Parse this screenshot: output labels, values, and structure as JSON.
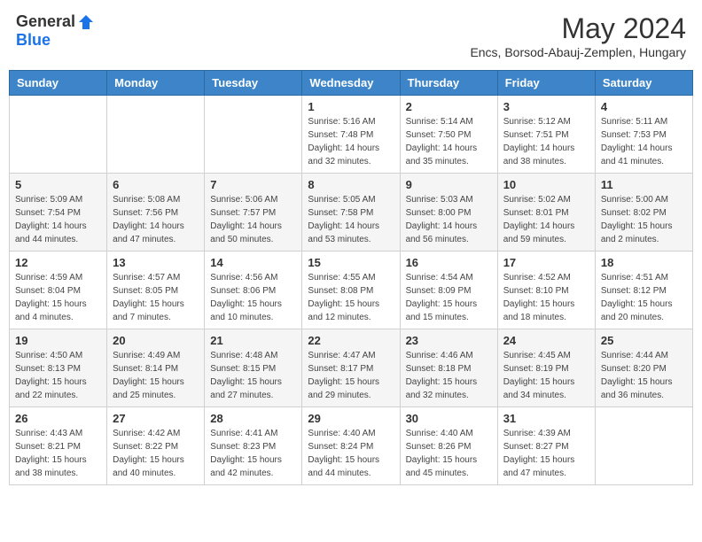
{
  "header": {
    "logo_general": "General",
    "logo_blue": "Blue",
    "month_title": "May 2024",
    "location": "Encs, Borsod-Abauj-Zemplen, Hungary"
  },
  "days_of_week": [
    "Sunday",
    "Monday",
    "Tuesday",
    "Wednesday",
    "Thursday",
    "Friday",
    "Saturday"
  ],
  "weeks": [
    [
      {
        "day": "",
        "info": ""
      },
      {
        "day": "",
        "info": ""
      },
      {
        "day": "",
        "info": ""
      },
      {
        "day": "1",
        "info": "Sunrise: 5:16 AM\nSunset: 7:48 PM\nDaylight: 14 hours and 32 minutes."
      },
      {
        "day": "2",
        "info": "Sunrise: 5:14 AM\nSunset: 7:50 PM\nDaylight: 14 hours and 35 minutes."
      },
      {
        "day": "3",
        "info": "Sunrise: 5:12 AM\nSunset: 7:51 PM\nDaylight: 14 hours and 38 minutes."
      },
      {
        "day": "4",
        "info": "Sunrise: 5:11 AM\nSunset: 7:53 PM\nDaylight: 14 hours and 41 minutes."
      }
    ],
    [
      {
        "day": "5",
        "info": "Sunrise: 5:09 AM\nSunset: 7:54 PM\nDaylight: 14 hours and 44 minutes."
      },
      {
        "day": "6",
        "info": "Sunrise: 5:08 AM\nSunset: 7:56 PM\nDaylight: 14 hours and 47 minutes."
      },
      {
        "day": "7",
        "info": "Sunrise: 5:06 AM\nSunset: 7:57 PM\nDaylight: 14 hours and 50 minutes."
      },
      {
        "day": "8",
        "info": "Sunrise: 5:05 AM\nSunset: 7:58 PM\nDaylight: 14 hours and 53 minutes."
      },
      {
        "day": "9",
        "info": "Sunrise: 5:03 AM\nSunset: 8:00 PM\nDaylight: 14 hours and 56 minutes."
      },
      {
        "day": "10",
        "info": "Sunrise: 5:02 AM\nSunset: 8:01 PM\nDaylight: 14 hours and 59 minutes."
      },
      {
        "day": "11",
        "info": "Sunrise: 5:00 AM\nSunset: 8:02 PM\nDaylight: 15 hours and 2 minutes."
      }
    ],
    [
      {
        "day": "12",
        "info": "Sunrise: 4:59 AM\nSunset: 8:04 PM\nDaylight: 15 hours and 4 minutes."
      },
      {
        "day": "13",
        "info": "Sunrise: 4:57 AM\nSunset: 8:05 PM\nDaylight: 15 hours and 7 minutes."
      },
      {
        "day": "14",
        "info": "Sunrise: 4:56 AM\nSunset: 8:06 PM\nDaylight: 15 hours and 10 minutes."
      },
      {
        "day": "15",
        "info": "Sunrise: 4:55 AM\nSunset: 8:08 PM\nDaylight: 15 hours and 12 minutes."
      },
      {
        "day": "16",
        "info": "Sunrise: 4:54 AM\nSunset: 8:09 PM\nDaylight: 15 hours and 15 minutes."
      },
      {
        "day": "17",
        "info": "Sunrise: 4:52 AM\nSunset: 8:10 PM\nDaylight: 15 hours and 18 minutes."
      },
      {
        "day": "18",
        "info": "Sunrise: 4:51 AM\nSunset: 8:12 PM\nDaylight: 15 hours and 20 minutes."
      }
    ],
    [
      {
        "day": "19",
        "info": "Sunrise: 4:50 AM\nSunset: 8:13 PM\nDaylight: 15 hours and 22 minutes."
      },
      {
        "day": "20",
        "info": "Sunrise: 4:49 AM\nSunset: 8:14 PM\nDaylight: 15 hours and 25 minutes."
      },
      {
        "day": "21",
        "info": "Sunrise: 4:48 AM\nSunset: 8:15 PM\nDaylight: 15 hours and 27 minutes."
      },
      {
        "day": "22",
        "info": "Sunrise: 4:47 AM\nSunset: 8:17 PM\nDaylight: 15 hours and 29 minutes."
      },
      {
        "day": "23",
        "info": "Sunrise: 4:46 AM\nSunset: 8:18 PM\nDaylight: 15 hours and 32 minutes."
      },
      {
        "day": "24",
        "info": "Sunrise: 4:45 AM\nSunset: 8:19 PM\nDaylight: 15 hours and 34 minutes."
      },
      {
        "day": "25",
        "info": "Sunrise: 4:44 AM\nSunset: 8:20 PM\nDaylight: 15 hours and 36 minutes."
      }
    ],
    [
      {
        "day": "26",
        "info": "Sunrise: 4:43 AM\nSunset: 8:21 PM\nDaylight: 15 hours and 38 minutes."
      },
      {
        "day": "27",
        "info": "Sunrise: 4:42 AM\nSunset: 8:22 PM\nDaylight: 15 hours and 40 minutes."
      },
      {
        "day": "28",
        "info": "Sunrise: 4:41 AM\nSunset: 8:23 PM\nDaylight: 15 hours and 42 minutes."
      },
      {
        "day": "29",
        "info": "Sunrise: 4:40 AM\nSunset: 8:24 PM\nDaylight: 15 hours and 44 minutes."
      },
      {
        "day": "30",
        "info": "Sunrise: 4:40 AM\nSunset: 8:26 PM\nDaylight: 15 hours and 45 minutes."
      },
      {
        "day": "31",
        "info": "Sunrise: 4:39 AM\nSunset: 8:27 PM\nDaylight: 15 hours and 47 minutes."
      },
      {
        "day": "",
        "info": ""
      }
    ]
  ]
}
